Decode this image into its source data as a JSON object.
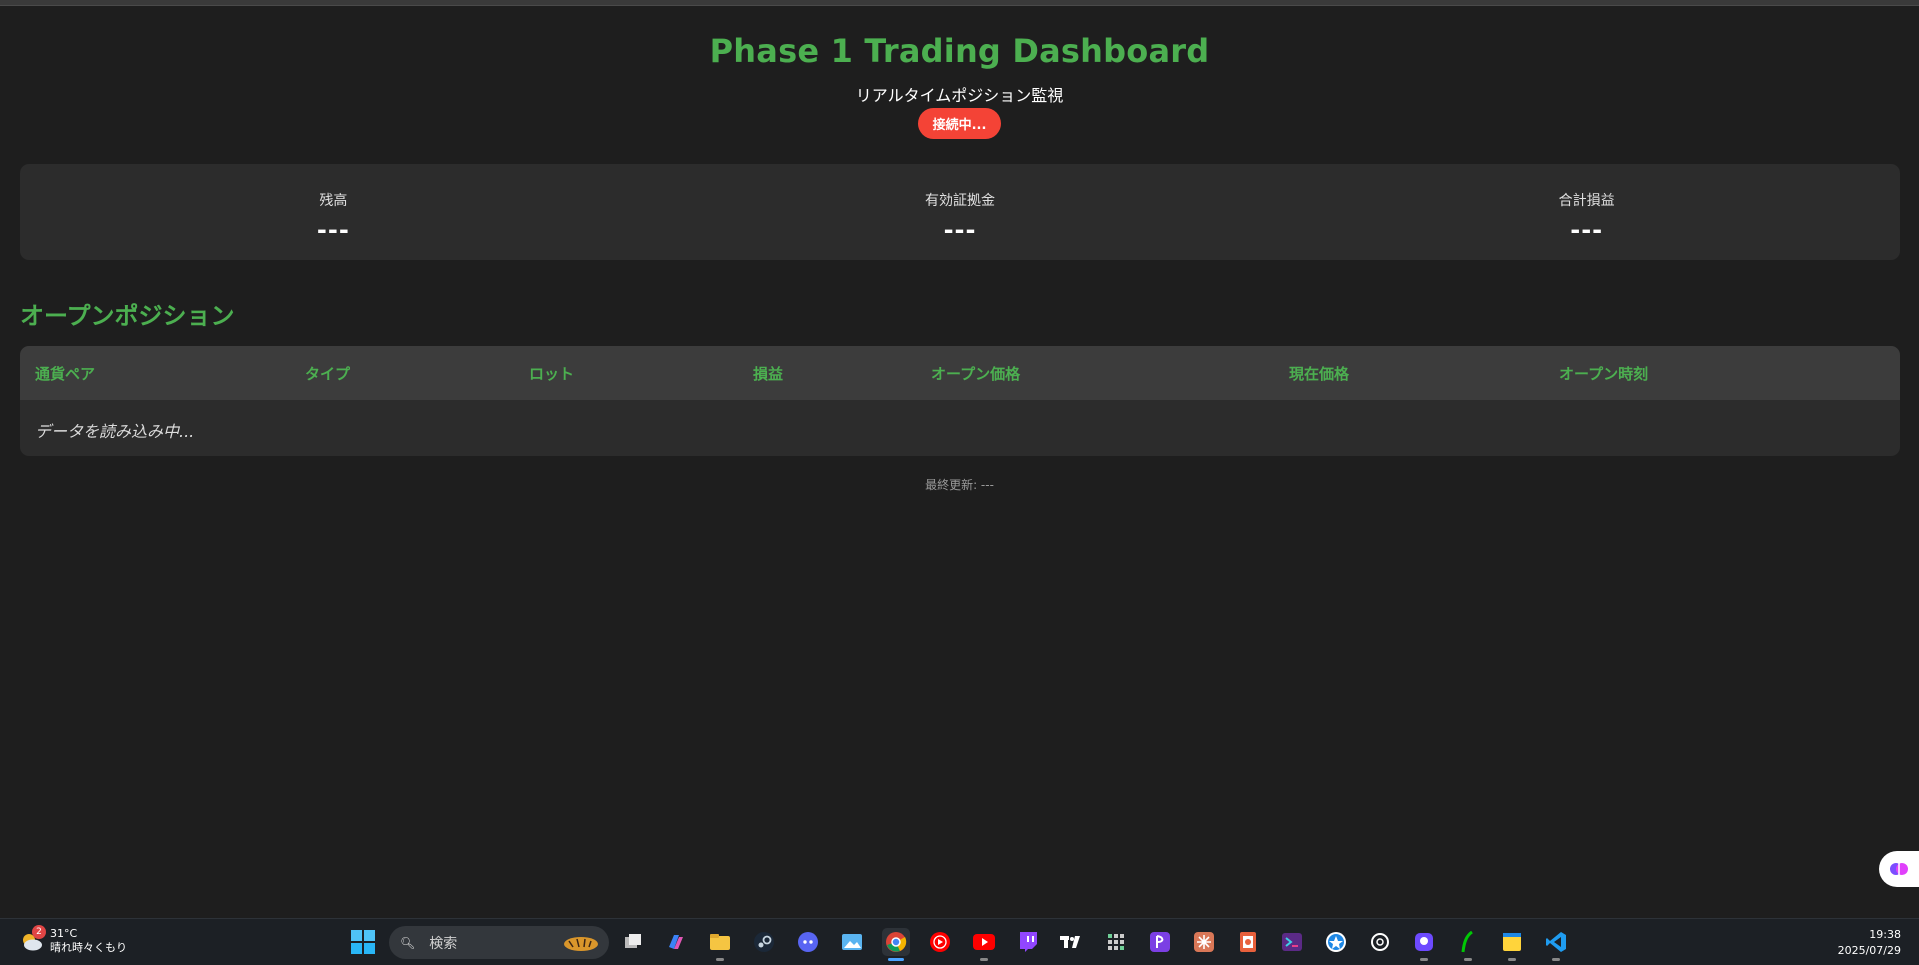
{
  "header": {
    "title": "Phase 1 Trading Dashboard",
    "subtitle": "リアルタイムポジション監視",
    "status": "接続中..."
  },
  "summary": [
    {
      "label": "残高",
      "value": "---"
    },
    {
      "label": "有効証拠金",
      "value": "---"
    },
    {
      "label": "合計損益",
      "value": "---"
    }
  ],
  "positions": {
    "title": "オープンポジション",
    "columns": [
      "通貨ペア",
      "タイプ",
      "ロット",
      "損益",
      "オープン価格",
      "現在価格",
      "オープン時刻"
    ],
    "loading": "データを読み込み中..."
  },
  "footer": {
    "last_updated": "最終更新: ---"
  },
  "taskbar": {
    "weather_temp": "31°C",
    "weather_desc": "晴れ時々くもり",
    "weather_badge": "2",
    "search_placeholder": "検索",
    "time": "19:38",
    "date": "2025/07/29",
    "apps": [
      "task-view",
      "copilot",
      "file-explorer",
      "steam",
      "discord",
      "photos",
      "chrome",
      "youtube-music",
      "youtube",
      "twitch",
      "tradingview",
      "calculator",
      "playstation",
      "claude",
      "office",
      "terminal",
      "app-store",
      "chatgpt",
      "proton",
      "robinhood",
      "sticky-notes",
      "vscode"
    ]
  },
  "colors": {
    "accent": "#4caf50",
    "status_red": "#f44336",
    "background": "#1e1e1e",
    "panel": "#2c2c2c"
  }
}
